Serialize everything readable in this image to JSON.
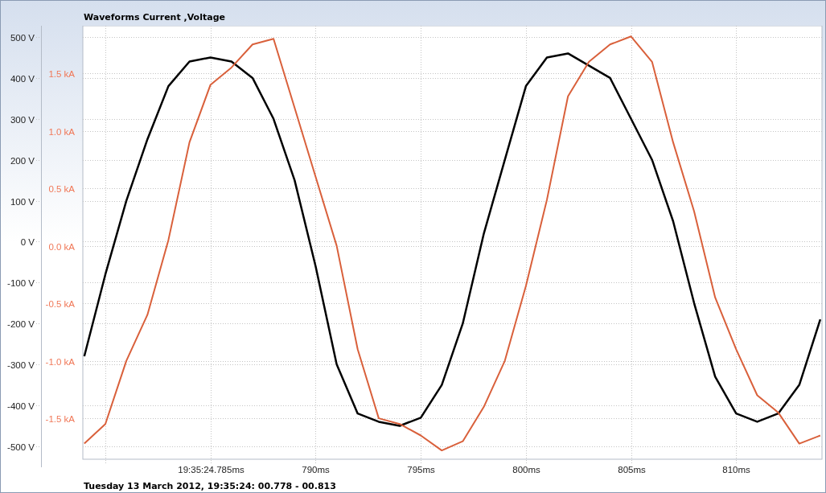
{
  "chart": {
    "footer": "Tuesday 13 March 2012, 19:35:24: 00.778 - 00.813",
    "chart_data": {
      "type": "line",
      "title": "Waveforms Current ,Voltage",
      "grid": true,
      "x": [
        779,
        780,
        781,
        782,
        783,
        784,
        785,
        786,
        787,
        788,
        789,
        790,
        791,
        792,
        793,
        794,
        795,
        796,
        797,
        798,
        799,
        800,
        801,
        802,
        803,
        804,
        805,
        806,
        807,
        808,
        809,
        810,
        811,
        812,
        813,
        814
      ],
      "xlim": [
        778.93,
        814.08
      ],
      "xticks": [
        {
          "value": 785,
          "label": "19:35:24.785ms"
        },
        {
          "value": 790,
          "label": "790ms"
        },
        {
          "value": 795,
          "label": "795ms"
        },
        {
          "value": 800,
          "label": "800ms"
        },
        {
          "value": 805,
          "label": "805ms"
        },
        {
          "value": 810,
          "label": "810ms"
        }
      ],
      "ylim": [
        -531.6,
        527.5
      ],
      "yticks": [
        {
          "value": 500,
          "label": "500 V"
        },
        {
          "value": 400,
          "label": "400 V"
        },
        {
          "value": 300,
          "label": "300 V"
        },
        {
          "value": 200,
          "label": "200 V"
        },
        {
          "value": 100,
          "label": "100 V"
        },
        {
          "value": 0,
          "label": "0 V"
        },
        {
          "value": -100,
          "label": "-100 V"
        },
        {
          "value": -200,
          "label": "-200 V"
        },
        {
          "value": -300,
          "label": "-300 V"
        },
        {
          "value": -400,
          "label": "-400 V"
        },
        {
          "value": -500,
          "label": "-500 V"
        }
      ],
      "y2lim": [
        -1.856,
        1.913
      ],
      "y2ticks": [
        {
          "value": 1.5,
          "label": "1.5 kA"
        },
        {
          "value": 1.0,
          "label": "1.0 kA"
        },
        {
          "value": 0.5,
          "label": "0.5 kA"
        },
        {
          "value": 0.0,
          "label": "0.0 kA"
        },
        {
          "value": -0.5,
          "label": "-0.5 kA"
        },
        {
          "value": -1.0,
          "label": "-1.0 kA"
        },
        {
          "value": -1.5,
          "label": "-1.5 kA"
        }
      ],
      "series": [
        {
          "color": "#000000",
          "axis": "y",
          "values": [
            -280,
            -80,
            100,
            250,
            380,
            440,
            450,
            440,
            400,
            300,
            150,
            -60,
            -300,
            -420,
            -440,
            -450,
            -430,
            -350,
            -200,
            20,
            200,
            380,
            450,
            460,
            430,
            400,
            300,
            200,
            50,
            -150,
            -330,
            -420,
            -440,
            -420,
            -350,
            -190
          ]
        },
        {
          "color": "#d9603b",
          "axis": "y2",
          "values": [
            -1.72,
            -1.55,
            -1.0,
            -0.6,
            0.05,
            0.9,
            1.4,
            1.55,
            1.75,
            1.8,
            1.2,
            0.6,
            0.0,
            -0.9,
            -1.5,
            -1.55,
            -1.65,
            -1.78,
            -1.7,
            -1.4,
            -1.0,
            -0.35,
            0.4,
            1.3,
            1.6,
            1.75,
            1.82,
            1.6,
            0.9,
            0.3,
            -0.45,
            -0.9,
            -1.3,
            -1.45,
            -1.72,
            -1.65
          ]
        }
      ]
    }
  }
}
